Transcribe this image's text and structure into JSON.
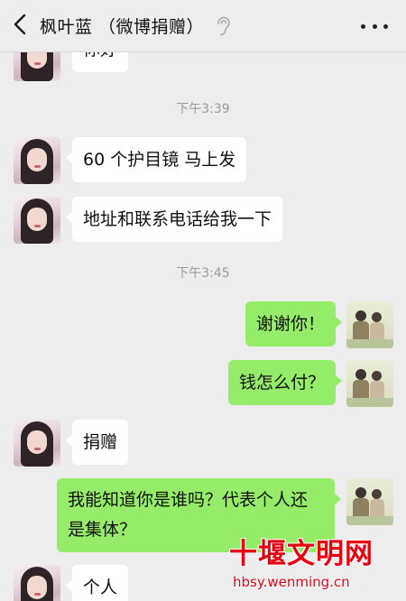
{
  "header": {
    "title": "枫叶蓝 （微博捐赠）",
    "back_icon": "chevron-left-icon",
    "mode_icon": "ear-icon",
    "more_icon": "more-dots-icon"
  },
  "messages": [
    {
      "side": "in",
      "text": "你好"
    },
    {
      "type": "time",
      "text": "下午3:39"
    },
    {
      "side": "in",
      "text": "60 个护目镜 马上发"
    },
    {
      "side": "in",
      "text": "地址和联系电话给我一下"
    },
    {
      "type": "time",
      "text": "下午3:45"
    },
    {
      "side": "out",
      "text": "谢谢你！"
    },
    {
      "side": "out",
      "text": "钱怎么付？"
    },
    {
      "side": "in",
      "text": "捐赠"
    },
    {
      "side": "out",
      "text": "我能知道你是谁吗？代表个人还是集体？"
    },
    {
      "side": "in",
      "text": "个人"
    }
  ],
  "watermark": {
    "title": "十堰文明网",
    "url": "hbsy.wenming.cn"
  },
  "colors": {
    "background": "#ededed",
    "bubble_in": "#ffffff",
    "bubble_out": "#95ec69",
    "watermark": "#e60012"
  }
}
